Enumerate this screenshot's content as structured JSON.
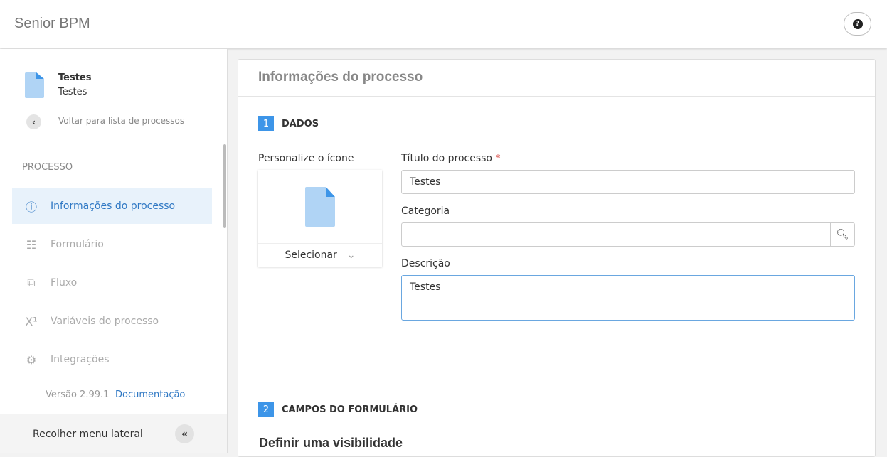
{
  "app": {
    "title": "Senior BPM"
  },
  "sidebar": {
    "process_name": "Testes",
    "process_desc": "Testes",
    "back_label": "Voltar para lista de processos",
    "section": "PROCESSO",
    "items": [
      {
        "label": "Informações do processo",
        "icon": "ⓘ"
      },
      {
        "label": "Formulário",
        "icon": "☷"
      },
      {
        "label": "Fluxo",
        "icon": "⧉"
      },
      {
        "label": "Variáveis do processo",
        "icon": "X¹"
      },
      {
        "label": "Integrações",
        "icon": "⚙"
      }
    ],
    "version": "Versão 2.99.1",
    "doc_link": "Documentação",
    "collapse_label": "Recolher menu lateral"
  },
  "main": {
    "title": "Informações do processo",
    "step1": {
      "num": "1",
      "label": "DADOS"
    },
    "icon_label": "Personalize o ícone",
    "select_label": "Selecionar",
    "title_label": "Título do processo",
    "required": "*",
    "title_value": "Testes",
    "category_label": "Categoria",
    "category_value": "",
    "desc_label": "Descrição",
    "desc_value": "Testes",
    "step2": {
      "num": "2",
      "label": "CAMPOS DO FORMULÁRIO"
    },
    "visibility_title": "Definir uma visibilidade"
  }
}
